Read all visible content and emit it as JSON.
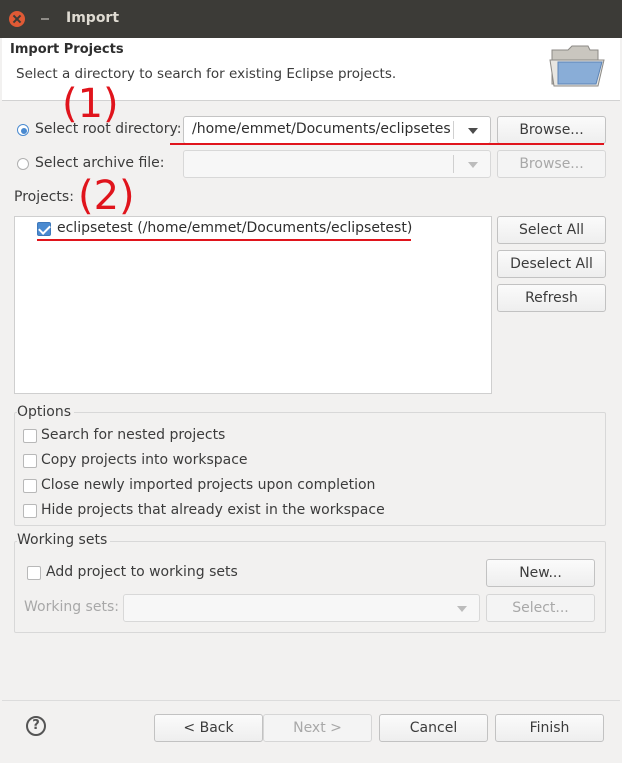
{
  "window": {
    "title": "Import"
  },
  "header": {
    "title": "Import Projects",
    "description": "Select a directory to search for existing Eclipse projects.",
    "icon": "folder-icon"
  },
  "source": {
    "root_dir_label": "Select root directory:",
    "root_dir_value": "/home/emmet/Documents/eclipsetes",
    "root_dir_selected": true,
    "archive_label": "Select archive file:",
    "archive_value": "",
    "browse_label": "Browse...",
    "archive_browse_label": "Browse..."
  },
  "annotations": {
    "first": "(1)",
    "second": "(2)",
    "color": "#e0141c"
  },
  "projects": {
    "label": "Projects:",
    "items": [
      {
        "name": "eclipsetest (/home/emmet/Documents/eclipsetest)",
        "checked": true
      }
    ],
    "select_all": "Select All",
    "deselect_all": "Deselect All",
    "refresh": "Refresh"
  },
  "options": {
    "title": "Options",
    "items": [
      {
        "label": "Search for nested projects",
        "checked": false
      },
      {
        "label": "Copy projects into workspace",
        "checked": false
      },
      {
        "label": "Close newly imported projects upon completion",
        "checked": false
      },
      {
        "label": "Hide projects that already exist in the workspace",
        "checked": false
      }
    ]
  },
  "working_sets": {
    "title": "Working sets",
    "add_label": "Add project to working sets",
    "add_checked": false,
    "new_label": "New...",
    "sets_label": "Working sets:",
    "sets_value": "",
    "select_label": "Select..."
  },
  "footer": {
    "help_icon": "help-icon",
    "back": "< Back",
    "next": "Next >",
    "cancel": "Cancel",
    "finish": "Finish"
  },
  "colors": {
    "accent": "#4a8ad0",
    "titlebar": "#3c3b37",
    "close": "#e05a35",
    "annotation": "#e0141c"
  }
}
